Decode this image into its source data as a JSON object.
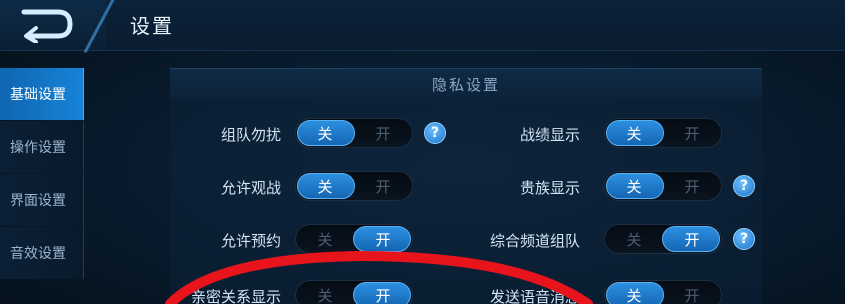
{
  "header": {
    "title": "设置",
    "back_icon": "back-arrow-icon"
  },
  "sidebar": {
    "items": [
      {
        "label": "基础设置",
        "active": true
      },
      {
        "label": "操作设置",
        "active": false
      },
      {
        "label": "界面设置",
        "active": false
      },
      {
        "label": "音效设置",
        "active": false
      }
    ]
  },
  "panel": {
    "title": "隐私设置"
  },
  "toggle_labels": {
    "off": "关",
    "on": "开"
  },
  "settings_left": [
    {
      "label": "组队勿扰",
      "state": "关",
      "help": true
    },
    {
      "label": "允许观战",
      "state": "关",
      "help": false
    },
    {
      "label": "允许预约",
      "state": "开",
      "help": false
    },
    {
      "label": "亲密关系显示",
      "state": "开",
      "help": false
    }
  ],
  "settings_right": [
    {
      "label": "战绩显示",
      "state": "关",
      "help": false
    },
    {
      "label": "贵族显示",
      "state": "关",
      "help": true
    },
    {
      "label": "综合频道组队",
      "state": "开",
      "help": true
    },
    {
      "label": "发送语音消息",
      "state": "关",
      "help": false
    }
  ],
  "help_glyph": "?",
  "colors": {
    "accent": "#1684d8",
    "annotation_red": "#e8141c"
  }
}
